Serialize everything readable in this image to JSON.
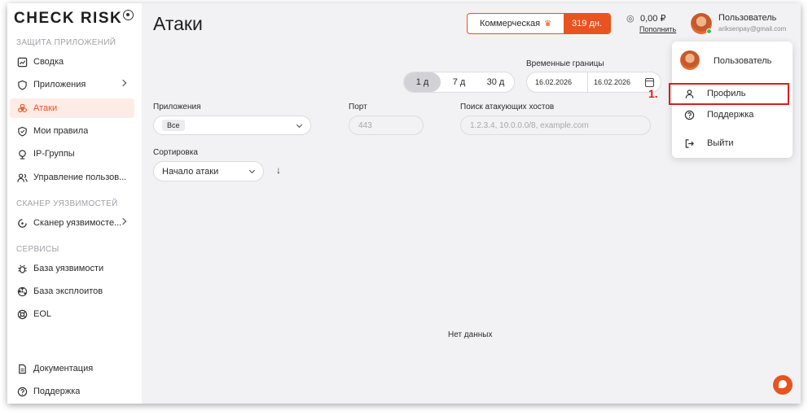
{
  "brand": {
    "logo": "CHECK RISK"
  },
  "sidebar": {
    "sections": [
      {
        "title": "ЗАЩИТА ПРИЛОЖЕНИЙ"
      },
      {
        "title": "СКАНЕР УЯЗВИМОСТЕЙ"
      },
      {
        "title": "СЕРВИСЫ"
      }
    ],
    "items": [
      {
        "label": "Сводка",
        "icon": "dashboard-icon"
      },
      {
        "label": "Приложения",
        "icon": "shield-icon"
      },
      {
        "label": "Атаки",
        "icon": "biohazard-icon",
        "active": true
      },
      {
        "label": "Мои правила",
        "icon": "rules-icon"
      },
      {
        "label": "IP-Группы",
        "icon": "globe-icon"
      },
      {
        "label": "Управление пользов...",
        "icon": "users-icon"
      },
      {
        "label": "Сканер уязвимосте...",
        "icon": "scanner-icon"
      },
      {
        "label": "База уязвимости",
        "icon": "bug-icon"
      },
      {
        "label": "База эксплоитов",
        "icon": "radiation-icon"
      },
      {
        "label": "EOL",
        "icon": "lifebuoy-icon"
      },
      {
        "label": "Документация",
        "icon": "document-icon"
      },
      {
        "label": "Поддержка",
        "icon": "help-icon"
      }
    ]
  },
  "header": {
    "title": "Атаки",
    "plan_name": "Коммерческая",
    "plan_days": "319 дн.",
    "balance": "0,00 ₽",
    "topup": "Пополнить",
    "user_name": "Пользователь",
    "user_email": "ariksenpay@gmail.com"
  },
  "filters": {
    "periods": [
      "1 д",
      "7 д",
      "30 д"
    ],
    "active_period": "1 д",
    "time_bounds_label": "Временные границы",
    "date_from": "16.02.2026",
    "date_to": "16.02.2026",
    "apps_label": "Приложения",
    "apps_value": "Все",
    "port_label": "Порт",
    "port_placeholder": "443",
    "hosts_label": "Поиск атакующих хостов",
    "hosts_placeholder": "1.2.3.4, 10.0.0.0/8, example.com",
    "sort_label": "Сортировка",
    "sort_value": "Начало атаки",
    "sort_direction": "↓"
  },
  "content": {
    "empty_text": "Нет данных"
  },
  "user_menu": {
    "user_name": "Пользователь",
    "items": [
      {
        "label": "Профиль",
        "icon": "user-icon"
      },
      {
        "label": "Поддержка",
        "icon": "help-icon"
      },
      {
        "label": "Выйти",
        "icon": "logout-icon"
      }
    ]
  },
  "annotation": {
    "step": "1."
  },
  "colors": {
    "accent": "#e8531f",
    "highlight": "#d81e1e",
    "online": "#2fbf5a"
  }
}
